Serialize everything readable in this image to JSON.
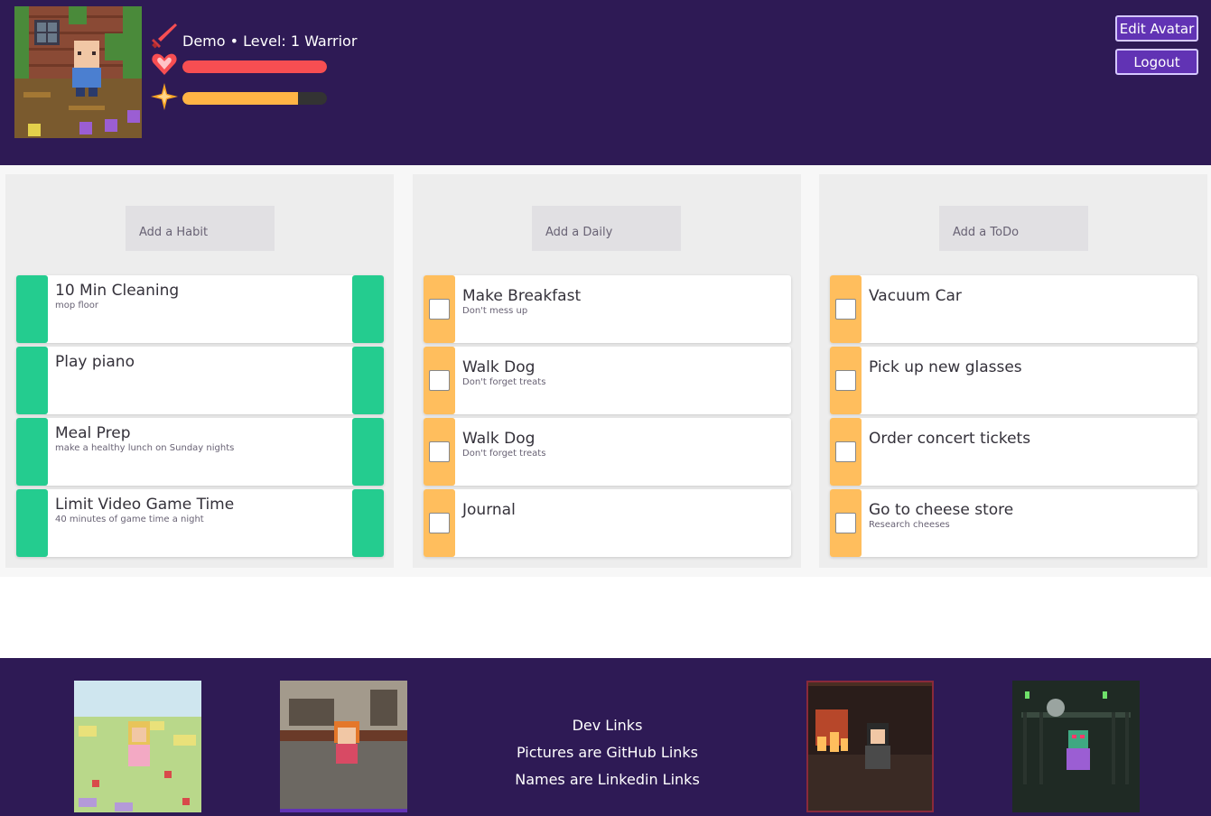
{
  "user": {
    "line": "Demo • Level: 1 Warrior",
    "hp_fraction": 1.0,
    "xp_fraction": 0.8
  },
  "buttons": {
    "edit_avatar": "Edit Avatar",
    "logout": "Logout"
  },
  "habits": {
    "add_label": "Add a Habit",
    "items": [
      {
        "title": "10 Min Cleaning",
        "notes": "mop floor"
      },
      {
        "title": "Play piano",
        "notes": ""
      },
      {
        "title": "Meal Prep",
        "notes": "make a healthy lunch on Sunday nights"
      },
      {
        "title": "Limit Video Game Time",
        "notes": "40 minutes of game time a night"
      }
    ]
  },
  "dailies": {
    "add_label": "Add a Daily",
    "items": [
      {
        "title": "Make Breakfast",
        "notes": "Don't mess up"
      },
      {
        "title": "Walk Dog",
        "notes": "Don't forget treats"
      },
      {
        "title": "Walk Dog",
        "notes": "Don't forget treats"
      },
      {
        "title": "Journal",
        "notes": ""
      }
    ]
  },
  "todos": {
    "add_label": "Add a ToDo",
    "items": [
      {
        "title": "Vacuum Car",
        "notes": ""
      },
      {
        "title": "Pick up new glasses",
        "notes": ""
      },
      {
        "title": "Order concert tickets",
        "notes": ""
      },
      {
        "title": "Go to cheese store",
        "notes": "Research cheeses"
      }
    ]
  },
  "footer": {
    "line1": "Dev Links",
    "line2": "Pictures are GitHub Links",
    "line3": "Names are Linkedin Links"
  },
  "colors": {
    "header_bg": "#2e1a55",
    "habit_green": "#24cc8f",
    "daily_orange": "#ffbe5d",
    "hp_red": "#f74e52",
    "xp_orange": "#ffb445",
    "button_purple": "#6133b4"
  },
  "icons": {
    "sword": "sword-icon",
    "heart": "heart-icon",
    "star": "star-icon"
  }
}
